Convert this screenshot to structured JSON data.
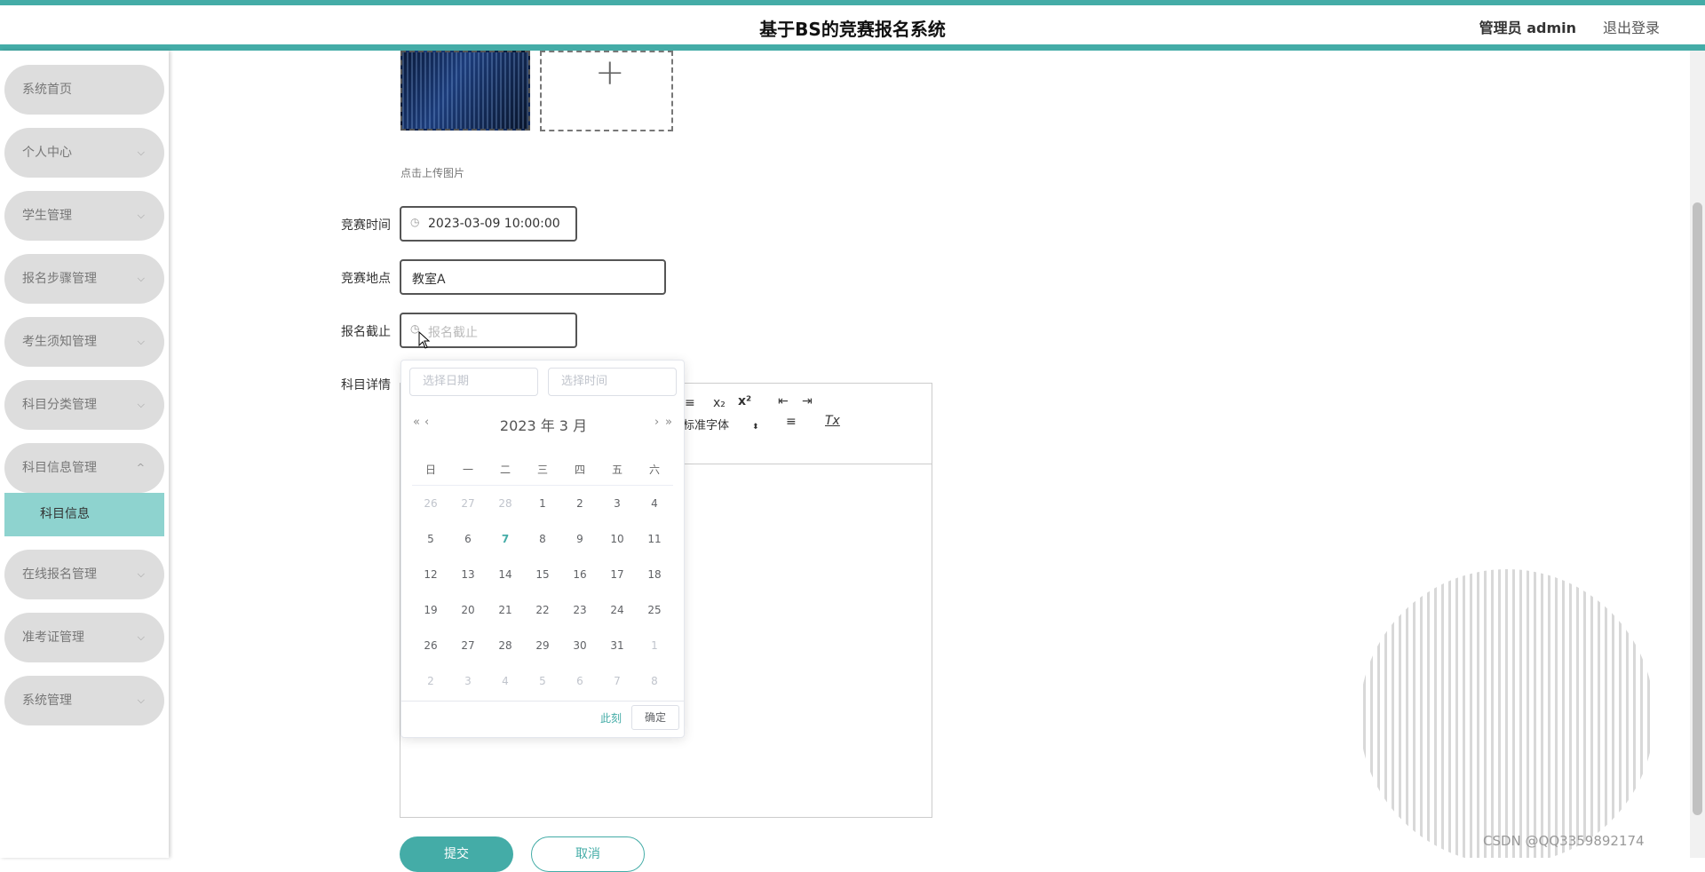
{
  "header": {
    "title": "基于BS的竞赛报名系统",
    "user_label": "管理员 admin",
    "logout_label": "退出登录"
  },
  "sidebar": {
    "items": [
      {
        "label": "系统首页",
        "chevron": ""
      },
      {
        "label": "个人中心",
        "chevron": "⌵"
      },
      {
        "label": "学生管理",
        "chevron": "⌵"
      },
      {
        "label": "报名步骤管理",
        "chevron": "⌵"
      },
      {
        "label": "考生须知管理",
        "chevron": "⌵"
      },
      {
        "label": "科目分类管理",
        "chevron": "⌵"
      },
      {
        "label": "科目信息管理",
        "chevron": "^"
      }
    ],
    "active_sub": "科目信息",
    "items_after": [
      {
        "label": "在线报名管理",
        "chevron": "⌵"
      },
      {
        "label": "准考证管理",
        "chevron": "⌵"
      },
      {
        "label": "系统管理",
        "chevron": "⌵"
      }
    ]
  },
  "form": {
    "upload_plus": "+",
    "upload_hint": "点击上传图片",
    "time_label": "竞赛时间",
    "time_value": "2023-03-09 10:00:00",
    "location_label": "竞赛地点",
    "location_value": "教室A",
    "deadline_label": "报名截止",
    "deadline_placeholder": "报名截止",
    "detail_label": "科目详情",
    "submit_label": "提交",
    "cancel_label": "取消"
  },
  "editor": {
    "toolbar_row1": [
      "≡",
      "x₂",
      "x²",
      "⇤",
      "⇥"
    ],
    "font_select": "标准字体",
    "align_icon": "≡",
    "clear_icon": "Tx"
  },
  "datepicker": {
    "date_placeholder": "选择日期",
    "time_placeholder": "选择时间",
    "prev_year": "«",
    "prev_month": "‹",
    "next_month": "›",
    "next_year": "»",
    "title": "2023 年  3 月",
    "weekdays": [
      "日",
      "一",
      "二",
      "三",
      "四",
      "五",
      "六"
    ],
    "weeks": [
      [
        "26",
        "27",
        "28",
        "1",
        "2",
        "3",
        "4"
      ],
      [
        "5",
        "6",
        "7",
        "8",
        "9",
        "10",
        "11"
      ],
      [
        "12",
        "13",
        "14",
        "15",
        "16",
        "17",
        "18"
      ],
      [
        "19",
        "20",
        "21",
        "22",
        "23",
        "24",
        "25"
      ],
      [
        "26",
        "27",
        "28",
        "29",
        "30",
        "31",
        "1"
      ],
      [
        "2",
        "3",
        "4",
        "5",
        "6",
        "7",
        "8"
      ]
    ],
    "today": "7",
    "now_label": "此刻",
    "ok_label": "确定"
  },
  "watermark": "CSDN @QQ3359892174",
  "colors": {
    "accent": "#44aca7",
    "submenu_bg": "#8ed3cf",
    "menu_bg": "#dddddd"
  }
}
